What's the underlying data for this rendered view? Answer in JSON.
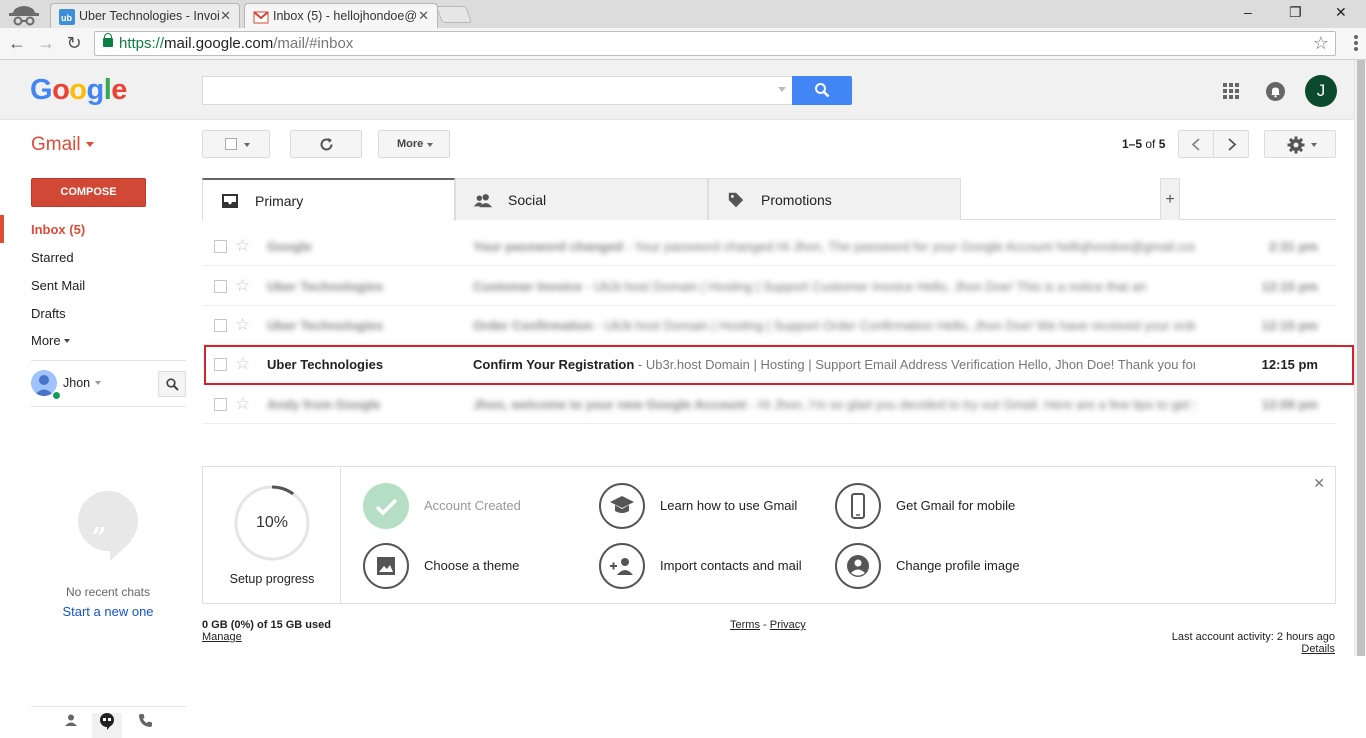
{
  "browser": {
    "tabs": [
      {
        "title": "Uber Technologies - Invoi",
        "active": false
      },
      {
        "title": "Inbox (5) - hellojhondoe@",
        "active": true
      }
    ],
    "url": {
      "scheme": "https://",
      "host": "mail.google.com",
      "path": "/mail/#inbox"
    },
    "window_controls": {
      "minimize": "–",
      "restore": "❐",
      "close": "✕"
    }
  },
  "header": {
    "logo": "Google",
    "search_placeholder": "",
    "avatar_initial": "J"
  },
  "toolbar": {
    "gmail_label": "Gmail",
    "more_label": "More",
    "pager": {
      "range": "1–5",
      "of": "of",
      "total": "5"
    }
  },
  "sidebar": {
    "compose": "COMPOSE",
    "nav": [
      {
        "label": "Inbox (5)",
        "active": true
      },
      {
        "label": "Starred"
      },
      {
        "label": "Sent Mail"
      },
      {
        "label": "Drafts"
      },
      {
        "label": "More"
      }
    ],
    "user_name": "Jhon",
    "no_chats": "No recent chats",
    "start_new": "Start a new one"
  },
  "category_tabs": [
    {
      "label": "Primary",
      "active": true
    },
    {
      "label": "Social"
    },
    {
      "label": "Promotions"
    }
  ],
  "emails": [
    {
      "sender": "Google",
      "subject": "Your password changed",
      "snippet": " - Your password changed Hi Jhon, The password for your Google Account hellojhondoe@gmail.com was",
      "time": "2:31 pm",
      "blurred": true
    },
    {
      "sender": "Uber Technologies",
      "subject": "Customer Invoice",
      "snippet": " - Ub3r.host Domain | Hosting | Support Customer Invoice Hello, Jhon Doe! This is a notice that an",
      "time": "12:15 pm",
      "blurred": true
    },
    {
      "sender": "Uber Technologies",
      "subject": "Order Confirmation",
      "snippet": " - Ub3r.host Domain | Hosting | Support Order Confirmation Hello, Jhon Doe! We have received your order",
      "time": "12:15 pm",
      "blurred": true
    },
    {
      "sender": "Uber Technologies",
      "subject": "Confirm Your Registration",
      "snippet": " - Ub3r.host Domain | Hosting | Support Email Address Verification Hello, Jhon Doe! Thank you for",
      "time": "12:15 pm",
      "blurred": false
    },
    {
      "sender": "Andy from Google",
      "subject": "Jhon, welcome to your new Google Account",
      "snippet": " - Hi Jhon, I'm so glad you decided to try out Gmail. Here are a few tips to get you up",
      "time": "12:09 pm",
      "blurred": true
    }
  ],
  "setup": {
    "percent": "10%",
    "progress_fraction": 0.1,
    "label": "Setup progress",
    "tasks": [
      {
        "label": "Account Created",
        "done": true,
        "icon": "check-icon"
      },
      {
        "label": "Learn how to use Gmail",
        "done": false,
        "icon": "graduation-cap-icon"
      },
      {
        "label": "Get Gmail for mobile",
        "done": false,
        "icon": "smartphone-icon"
      },
      {
        "label": "Choose a theme",
        "done": false,
        "icon": "image-icon"
      },
      {
        "label": "Import contacts and mail",
        "done": false,
        "icon": "add-contact-icon"
      },
      {
        "label": "Change profile image",
        "done": false,
        "icon": "profile-icon"
      }
    ]
  },
  "footer": {
    "storage": "0 GB (0%) of 15 GB used",
    "manage": "Manage",
    "terms": "Terms",
    "sep": " - ",
    "privacy": "Privacy",
    "activity": "Last account activity: 2 hours ago",
    "details": "Details"
  },
  "colors": {
    "gmail_red": "#dd4b39",
    "compose_red": "#d14836",
    "search_blue": "#4285f4",
    "highlight": "#d3232c"
  }
}
